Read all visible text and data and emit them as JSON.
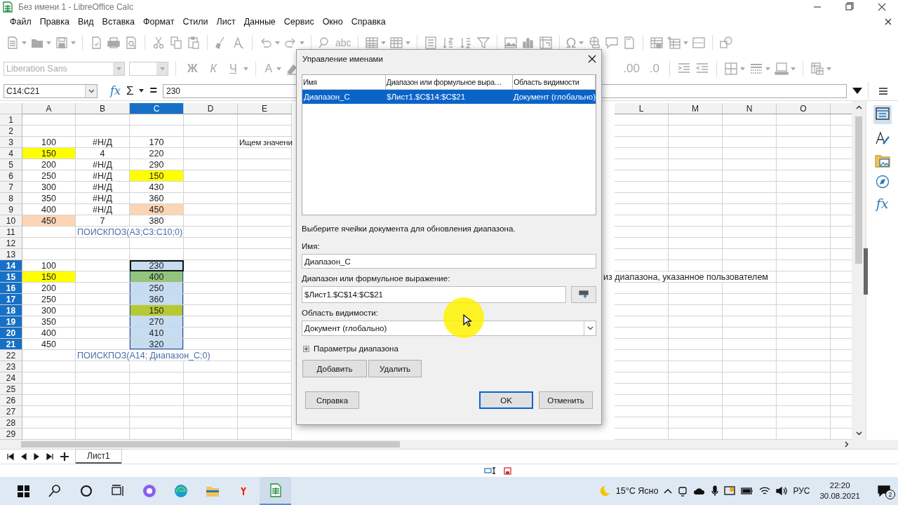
{
  "window": {
    "title": "Без имени 1 - LibreOffice Calc"
  },
  "menu": [
    "Файл",
    "Правка",
    "Вид",
    "Вставка",
    "Формат",
    "Стили",
    "Лист",
    "Данные",
    "Сервис",
    "Окно",
    "Справка"
  ],
  "toolbar": {
    "disabled": true,
    "font_name": "Liberation Sans",
    "spelling": "abc",
    "special_character": "Ω",
    "bold": "Ж",
    "italic": "К",
    "underline": "Ч",
    "font_color": "A",
    "add_decimal": ".00",
    "delete_decimal": ".0"
  },
  "formula_bar": {
    "name_box": "C14:C21",
    "function_glyph": "fx",
    "sum_glyph": "Σ",
    "equals_glyph": "=",
    "input": "230"
  },
  "sheet": {
    "columns": [
      {
        "label": "A",
        "selected": false
      },
      {
        "label": "B",
        "selected": false
      },
      {
        "label": "C",
        "selected": true
      },
      {
        "label": "D",
        "selected": false
      },
      {
        "label": "E",
        "selected": false
      },
      {
        "label": "L",
        "selected": false
      },
      {
        "label": "M",
        "selected": false
      },
      {
        "label": "N",
        "selected": false
      },
      {
        "label": "O",
        "selected": false
      }
    ],
    "rows": [
      {
        "label": "1",
        "selected": false
      },
      {
        "label": "2",
        "selected": false
      },
      {
        "label": "3",
        "selected": false,
        "cells": {
          "a": {
            "text": "100",
            "kind": "value"
          },
          "b": {
            "text": "#Н/Д",
            "kind": "value"
          },
          "c": {
            "text": "170",
            "kind": "value"
          },
          "e": {
            "text": "Ищем значени",
            "kind": "text"
          }
        }
      },
      {
        "label": "4",
        "selected": false,
        "cells": {
          "a": {
            "text": "150",
            "kind": "value",
            "color": "#ffff00"
          },
          "b": {
            "text": "4",
            "kind": "value"
          },
          "c": {
            "text": "220",
            "kind": "value"
          }
        }
      },
      {
        "label": "5",
        "selected": false,
        "cells": {
          "a": {
            "text": "200",
            "kind": "value"
          },
          "b": {
            "text": "#Н/Д",
            "kind": "value"
          },
          "c": {
            "text": "290",
            "kind": "value"
          }
        }
      },
      {
        "label": "6",
        "selected": false,
        "cells": {
          "a": {
            "text": "250",
            "kind": "value"
          },
          "b": {
            "text": "#Н/Д",
            "kind": "value"
          },
          "c": {
            "text": "150",
            "kind": "value",
            "color": "#ffff00"
          }
        }
      },
      {
        "label": "7",
        "selected": false,
        "cells": {
          "a": {
            "text": "300",
            "kind": "value"
          },
          "b": {
            "text": "#Н/Д",
            "kind": "value"
          },
          "c": {
            "text": "430",
            "kind": "value"
          }
        }
      },
      {
        "label": "8",
        "selected": false,
        "cells": {
          "a": {
            "text": "350",
            "kind": "value"
          },
          "b": {
            "text": "#Н/Д",
            "kind": "value"
          },
          "c": {
            "text": "360",
            "kind": "value"
          }
        }
      },
      {
        "label": "9",
        "selected": false,
        "cells": {
          "a": {
            "text": "400",
            "kind": "value"
          },
          "b": {
            "text": "#Н/Д",
            "kind": "value"
          },
          "c": {
            "text": "450",
            "kind": "value",
            "color": "#fcd5b4"
          }
        }
      },
      {
        "label": "10",
        "selected": false,
        "cells": {
          "a": {
            "text": "450",
            "kind": "value",
            "color": "#fcd5b4"
          },
          "b": {
            "text": "7",
            "kind": "value"
          },
          "c": {
            "text": "380",
            "kind": "value"
          }
        }
      },
      {
        "label": "11",
        "selected": false,
        "cells": {
          "b": {
            "text": "ПОИСКПОЗ(A3;C3:C10;0)",
            "kind": "formula"
          }
        }
      },
      {
        "label": "12",
        "selected": false
      },
      {
        "label": "13",
        "selected": false
      },
      {
        "label": "14",
        "selected": true,
        "cells": {
          "a": {
            "text": "100",
            "kind": "value"
          },
          "c": {
            "text": "230",
            "kind": "value",
            "active": true
          }
        }
      },
      {
        "label": "15",
        "selected": true,
        "cells": {
          "a": {
            "text": "150",
            "kind": "value",
            "color": "#ffff00"
          },
          "c": {
            "text": "400",
            "kind": "value",
            "color": "#93c47d"
          },
          "l": {
            "text": "из диапазона, указанное пользователем",
            "kind": "spill"
          }
        }
      },
      {
        "label": "16",
        "selected": true,
        "cells": {
          "a": {
            "text": "200",
            "kind": "value"
          },
          "c": {
            "text": "250",
            "kind": "value"
          }
        }
      },
      {
        "label": "17",
        "selected": true,
        "cells": {
          "a": {
            "text": "250",
            "kind": "value"
          },
          "c": {
            "text": "360",
            "kind": "value"
          }
        }
      },
      {
        "label": "18",
        "selected": true,
        "cells": {
          "a": {
            "text": "300",
            "kind": "value"
          },
          "c": {
            "text": "150",
            "kind": "value",
            "color": "#b5c935"
          }
        }
      },
      {
        "label": "19",
        "selected": true,
        "cells": {
          "a": {
            "text": "350",
            "kind": "value"
          },
          "c": {
            "text": "270",
            "kind": "value"
          }
        }
      },
      {
        "label": "20",
        "selected": true,
        "cells": {
          "a": {
            "text": "400",
            "kind": "value"
          },
          "c": {
            "text": "410",
            "kind": "value"
          }
        }
      },
      {
        "label": "21",
        "selected": true,
        "cells": {
          "a": {
            "text": "450",
            "kind": "value"
          },
          "c": {
            "text": "320",
            "kind": "value"
          }
        }
      },
      {
        "label": "22",
        "selected": false,
        "cells": {
          "b": {
            "text": "ПОИСКПОЗ(A14; Диапазон_C;0)",
            "kind": "formula"
          }
        }
      },
      {
        "label": "23",
        "selected": false
      },
      {
        "label": "24",
        "selected": false
      },
      {
        "label": "25",
        "selected": false
      },
      {
        "label": "26",
        "selected": false
      },
      {
        "label": "27",
        "selected": false
      },
      {
        "label": "28",
        "selected": false
      },
      {
        "label": "29",
        "selected": false
      }
    ]
  },
  "sidebar": {
    "functions_glyph": "fx"
  },
  "sheet_tabs": [
    {
      "label": "Лист1",
      "selected": true
    }
  ],
  "dialog": {
    "title": "Управление именами",
    "list_columns": [
      "Имя",
      "Диапазон или формульное выра…",
      "Область видимости"
    ],
    "names": [
      {
        "name": "Диапазон_C",
        "range": "$Лист1.$C$14:$C$21",
        "scope": "Документ (глобально)",
        "selected": true
      }
    ],
    "hint": "Выберите ячейки документа для обновления диапазона.",
    "name_label": "Имя:",
    "name_value": "Диапазон_C",
    "range_label": "Диапазон или формульное выражение:",
    "range_value": "$Лист1.$C$14:$C$21",
    "scope_label": "Область видимости:",
    "scope_value": "Документ (глобально)",
    "options_label": "Параметры диапазона",
    "options_expanded": false,
    "add_button": "Добавить",
    "delete_button": "Удалить",
    "help_button": "Справка",
    "ok_button": "OK",
    "cancel_button": "Отменить"
  },
  "taskbar": {
    "weather": "15°C Ясно",
    "language": "РУС",
    "time": "22:20",
    "date": "30.08.2021",
    "notifications": "2"
  }
}
